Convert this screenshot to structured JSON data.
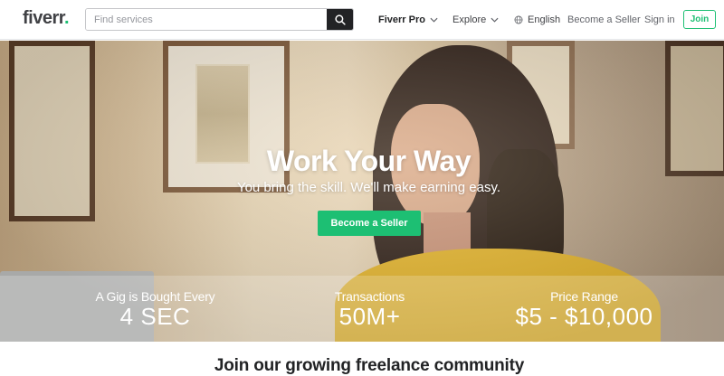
{
  "header": {
    "logo_text": "fiverr",
    "logo_dot": ".",
    "search_placeholder": "Find services",
    "fiverr_pro": "Fiverr Pro",
    "explore": "Explore",
    "language": "English",
    "become_seller": "Become a Seller",
    "sign_in": "Sign in",
    "join": "Join"
  },
  "hero": {
    "title": "Work Your Way",
    "subtitle": "You bring the skill. We'll make earning easy.",
    "cta_label": "Become a Seller"
  },
  "stats": [
    {
      "label": "A Gig is Bought Every",
      "value": "4 SEC"
    },
    {
      "label": "Transactions",
      "value": "50M+"
    },
    {
      "label": "Price Range",
      "value": "$5 - $10,000"
    }
  ],
  "section": {
    "title": "Join our growing freelance community"
  },
  "colors": {
    "brand_green": "#1dbf73",
    "dark": "#222325",
    "sweater_yellow": "#e3b42b"
  },
  "icons": [
    "search-icon",
    "chevron-down-icon",
    "globe-icon"
  ]
}
